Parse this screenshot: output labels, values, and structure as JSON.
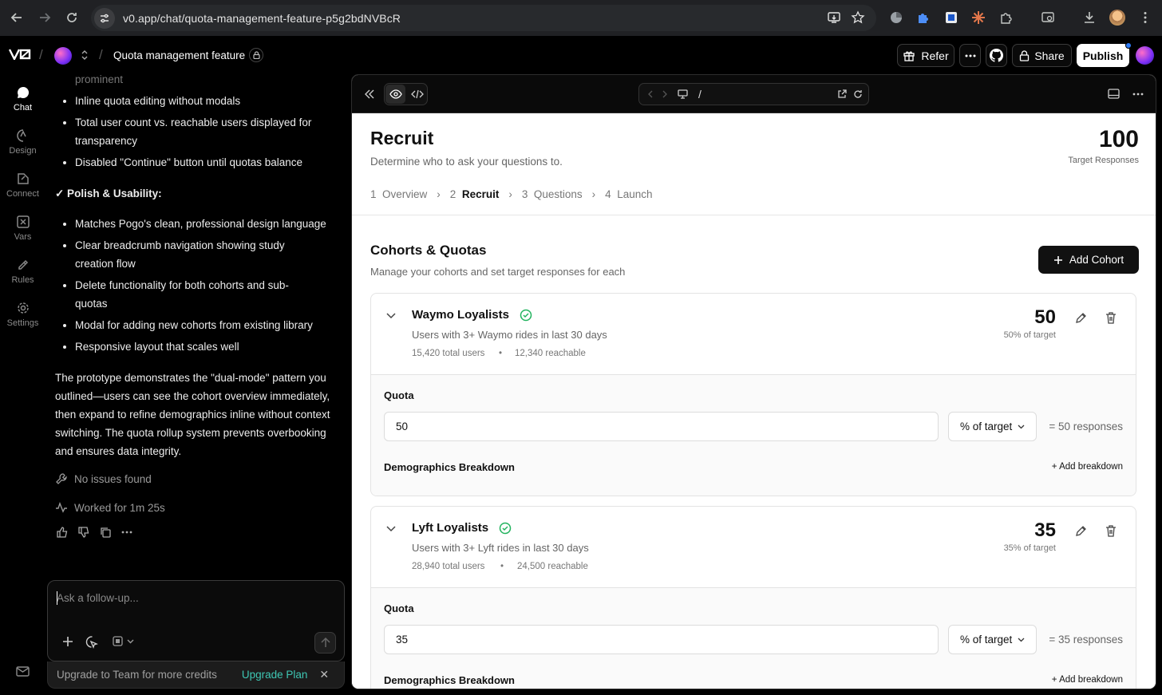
{
  "browser": {
    "url": "v0.app/chat/quota-management-feature-p5g2bdNVBcR"
  },
  "header": {
    "logo": "V0",
    "project_name": "Quota management feature",
    "refer_label": "Refer",
    "share_label": "Share",
    "publish_label": "Publish"
  },
  "rail": {
    "items": [
      {
        "label": "Chat",
        "icon": "chat-bubble-icon"
      },
      {
        "label": "Design",
        "icon": "design-icon"
      },
      {
        "label": "Connect",
        "icon": "connect-icon"
      },
      {
        "label": "Vars",
        "icon": "vars-icon"
      },
      {
        "label": "Rules",
        "icon": "rules-icon"
      },
      {
        "label": "Settings",
        "icon": "gear-icon"
      }
    ]
  },
  "chat": {
    "cut_text": "prominent",
    "bullets_a": [
      "Inline quota editing without modals",
      "Total user count vs. reachable users displayed for transparency",
      "Disabled \"Continue\" button until quotas balance"
    ],
    "polish_heading": "✓ Polish & Usability:",
    "bullets_b": [
      "Matches Pogo's clean, professional design language",
      "Clear breadcrumb navigation showing study creation flow",
      "Delete functionality for both cohorts and sub-quotas",
      "Modal for adding new cohorts from existing library",
      "Responsive layout that scales well"
    ],
    "paragraph": "The prototype demonstrates the \"dual-mode\" pattern you outlined—users can see the cohort overview immediately, then expand to refine demographics inline without context switching. The quota rollup system prevents overbooking and ensures data integrity.",
    "no_issues": "No issues found",
    "worked_for": "Worked for 1m 25s",
    "composer_placeholder": "Ask a follow-up...",
    "upgrade_text": "Upgrade to Team for more credits",
    "upgrade_link": "Upgrade Plan"
  },
  "preview": {
    "path": "/",
    "title": "Recruit",
    "subtitle": "Determine who to ask your questions to.",
    "target_value": "100",
    "target_label": "Target Responses",
    "steps": [
      {
        "num": "1",
        "label": "Overview"
      },
      {
        "num": "2",
        "label": "Recruit"
      },
      {
        "num": "3",
        "label": "Questions"
      },
      {
        "num": "4",
        "label": "Launch"
      }
    ],
    "section_title": "Cohorts & Quotas",
    "section_subtitle": "Manage your cohorts and set target responses for each",
    "add_cohort_label": "Add Cohort",
    "quota_label": "Quota",
    "select_value": "% of target",
    "demographics_label": "Demographics Breakdown",
    "add_breakdown_label": "+ Add breakdown",
    "cohorts": [
      {
        "name": "Waymo Loyalists",
        "description": "Users with 3+ Waymo rides in last 30 days",
        "total_users": "15,420 total users",
        "reachable": "12,340 reachable",
        "responses": "50",
        "pct_of_target": "50% of target",
        "quota_value": "50",
        "equals": "= 50 responses"
      },
      {
        "name": "Lyft Loyalists",
        "description": "Users with 3+ Lyft rides in last 30 days",
        "total_users": "28,940 total users",
        "reachable": "24,500 reachable",
        "responses": "35",
        "pct_of_target": "35% of target",
        "quota_value": "35",
        "equals": "= 35 responses"
      }
    ]
  }
}
